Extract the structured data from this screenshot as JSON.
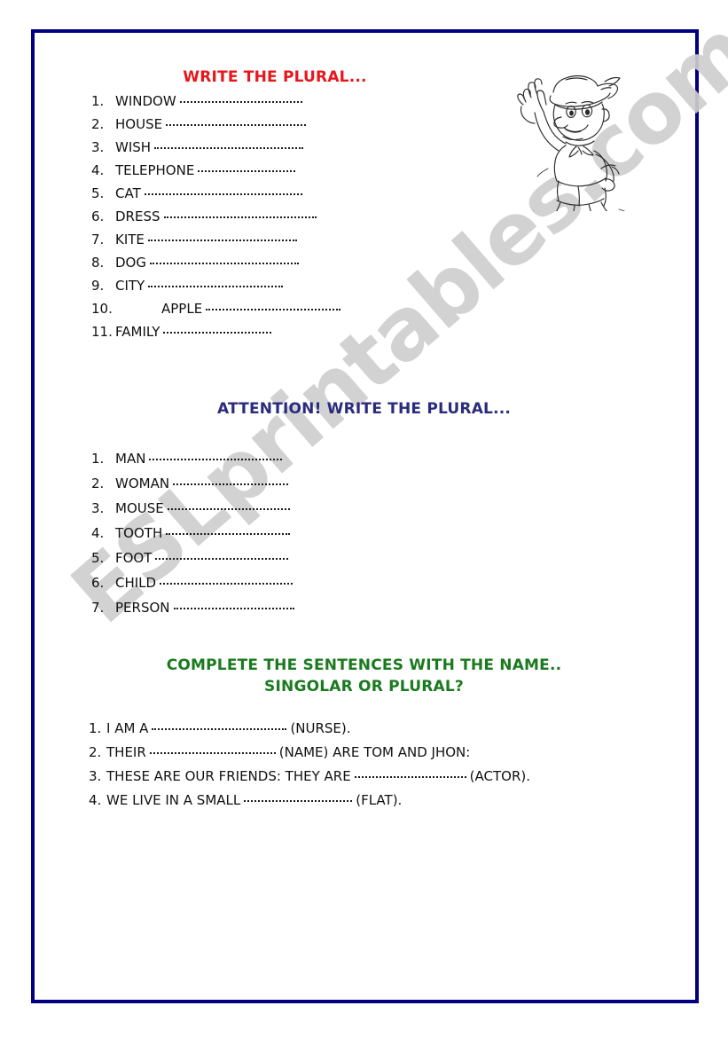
{
  "page": {
    "border_color": "#000080",
    "background": "#ffffff"
  },
  "watermark": {
    "text": "ESLprintables.com",
    "color": "#cfcfcf"
  },
  "clipart": {
    "name": "pinocchio-line-art",
    "description": "Black and white line drawing of Pinocchio waving"
  },
  "sections": [
    {
      "heading": "WRITE THE PLURAL...",
      "heading_color": "#e8161a",
      "items": [
        {
          "num": "1.",
          "word": "WINDOW",
          "dots": 138,
          "tail": ""
        },
        {
          "num": "2.",
          "word": "HOUSE",
          "dots": 158,
          "tail": ""
        },
        {
          "num": "3.",
          "word": "WISH",
          "dots": 168,
          "tail": ""
        },
        {
          "num": "4.",
          "word": "TELEPHONE",
          "dots": 110,
          "tail": ""
        },
        {
          "num": "5.",
          "word": "CAT",
          "dots": 178,
          "tail": ""
        },
        {
          "num": "6.",
          "word": "DRESS",
          "dots": 172,
          "tail": ""
        },
        {
          "num": "7.",
          "word": "KITE",
          "dots": 168,
          "tail": ""
        },
        {
          "num": "8.",
          "word": "DOG",
          "dots": 168,
          "tail": ""
        },
        {
          "num": "9.",
          "word": "CITY",
          "dots": 152,
          "tail": ""
        },
        {
          "num": "10.",
          "word": "APPLE",
          "dots": 152,
          "tail": "",
          "indent": 52
        },
        {
          "num": "11.",
          "word": "FAMILY",
          "dots": 122,
          "tail": ""
        }
      ]
    },
    {
      "heading": "ATTENTION! WRITE THE PLURAL...",
      "heading_color": "#2b2b7e",
      "items": [
        {
          "num": "1.",
          "word": "MAN",
          "dots": 150,
          "tail": ""
        },
        {
          "num": "2.",
          "word": "WOMAN",
          "dots": 130,
          "tail": ""
        },
        {
          "num": "3.",
          "word": "MOUSE",
          "dots": 138,
          "tail": ""
        },
        {
          "num": "4.",
          "word": "TOOTH",
          "dots": 140,
          "tail": ""
        },
        {
          "num": "5.",
          "word": "FOOT",
          "dots": 150,
          "tail": ""
        },
        {
          "num": "6.",
          "word": "CHILD",
          "dots": 150,
          "tail": ""
        },
        {
          "num": "7.",
          "word": "PERSON",
          "dots": 136,
          "tail": ""
        }
      ]
    },
    {
      "heading_line1": "COMPLETE THE SENTENCES WITH THE NAME..",
      "heading_line2": "SINGOLAR OR PLURAL?",
      "heading_color": "#1a7a1e",
      "items": [
        {
          "num": "1.",
          "word": "I AM A",
          "dots": 152,
          "tail": "(NURSE)."
        },
        {
          "num": "2.",
          "word": "THEIR",
          "dots": 142,
          "tail": "(NAME) ARE TOM AND JHON:"
        },
        {
          "num": "3.",
          "word": "THESE ARE OUR FRIENDS: THEY ARE",
          "dots": 126,
          "tail": "(ACTOR)."
        },
        {
          "num": "4.",
          "word": "WE LIVE IN A SMALL",
          "dots": 122,
          "tail": "(FLAT)."
        }
      ]
    }
  ]
}
